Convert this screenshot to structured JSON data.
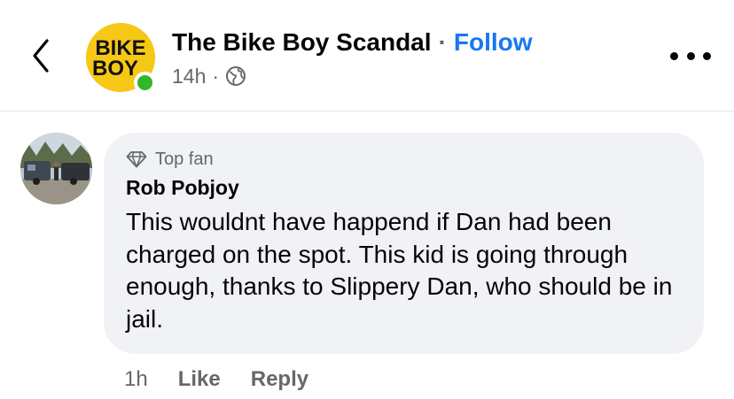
{
  "post_header": {
    "back_icon": "chevron-left-icon",
    "avatar_lines": [
      "BIKE",
      "BOY"
    ],
    "page_name": "The Bike Boy Scandal",
    "separator": "·",
    "follow_label": "Follow",
    "time": "14h",
    "meta_separator": "·",
    "audience_icon": "globe-icon",
    "more_icon": "more-horizontal-icon"
  },
  "comment": {
    "badge_icon": "diamond-icon",
    "badge_label": "Top fan",
    "author": "Rob Pobjoy",
    "text": "This wouldnt have happend if Dan had been charged on the spot. This kid is going through enough, thanks to Slippery Dan, who should be in jail.",
    "time": "1h",
    "like_label": "Like",
    "reply_label": "Reply"
  },
  "colors": {
    "brand_blue": "#1877f2",
    "online_green": "#31b62c",
    "logo_yellow": "#f6c816",
    "bubble_bg": "#f0f2f5",
    "secondary_text": "#65676b"
  }
}
